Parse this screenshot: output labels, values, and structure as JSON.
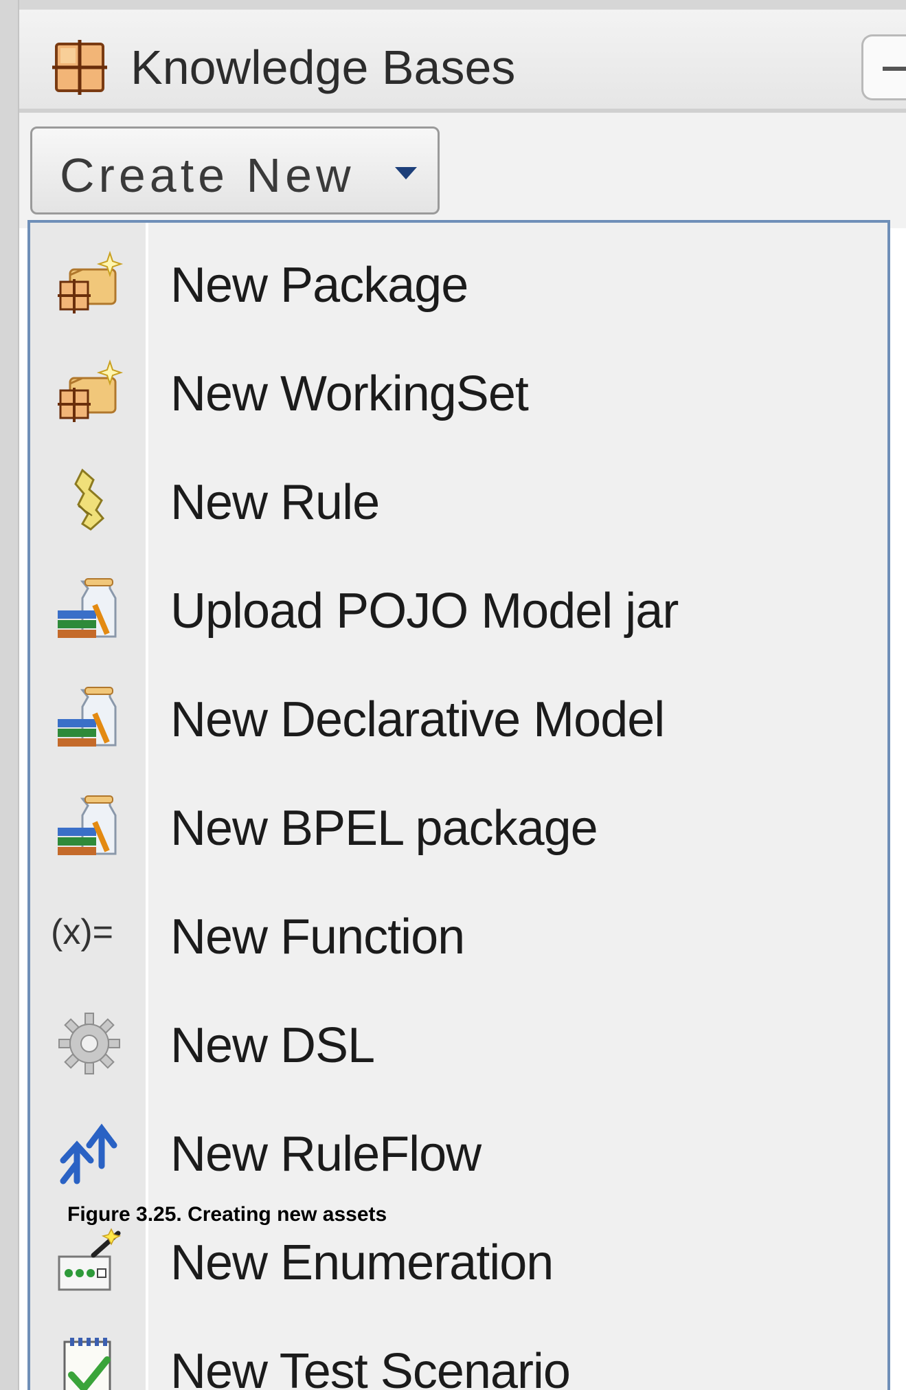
{
  "header": {
    "title": "Knowledge Bases",
    "icon": "knowledge-base-grid-icon"
  },
  "toolbar": {
    "create_button_label": "Create New",
    "dropdown_icon": "chevron-down-icon"
  },
  "menu": {
    "items": [
      {
        "label": "New Package",
        "icon": "new-package-icon"
      },
      {
        "label": "New WorkingSet",
        "icon": "new-workingset-icon"
      },
      {
        "label": "New Rule",
        "icon": "rule-scroll-icon"
      },
      {
        "label": "Upload POJO Model jar",
        "icon": "model-jar-icon"
      },
      {
        "label": "New Declarative Model",
        "icon": "model-jar-icon"
      },
      {
        "label": "New BPEL package",
        "icon": "model-jar-icon"
      },
      {
        "label": "New Function",
        "icon": "function-icon"
      },
      {
        "label": "New DSL",
        "icon": "gear-icon"
      },
      {
        "label": "New RuleFlow",
        "icon": "ruleflow-arrows-icon"
      },
      {
        "label": "New Enumeration",
        "icon": "enumeration-wand-icon"
      },
      {
        "label": "New Test Scenario",
        "icon": "test-scenario-check-icon"
      }
    ]
  },
  "function_icon_text": "(x)=",
  "caption": "Figure 3.25. Creating new assets",
  "colors": {
    "menu_border": "#6f8fb8",
    "dropdown_arrow": "#1d3f7a",
    "ruleflow_blue": "#2a62c4",
    "test_green": "#3aa43a"
  }
}
